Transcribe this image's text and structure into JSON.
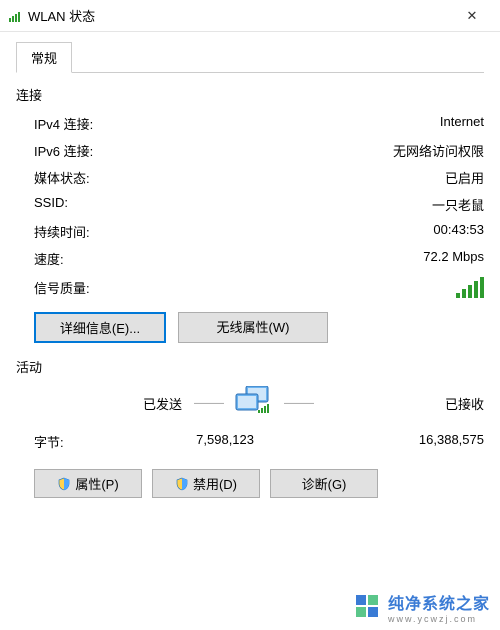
{
  "window": {
    "title": "WLAN 状态",
    "close_glyph": "✕"
  },
  "tabs": {
    "general": "常规"
  },
  "connection": {
    "label": "连接",
    "ipv4_label": "IPv4 连接:",
    "ipv4_value": "Internet",
    "ipv6_label": "IPv6 连接:",
    "ipv6_value": "无网络访问权限",
    "media_label": "媒体状态:",
    "media_value": "已启用",
    "ssid_label": "SSID:",
    "ssid_value": "一只老鼠",
    "duration_label": "持续时间:",
    "duration_value": "00:43:53",
    "speed_label": "速度:",
    "speed_value": "72.2 Mbps",
    "signal_label": "信号质量:"
  },
  "buttons": {
    "details": "详细信息(E)...",
    "wireless_props": "无线属性(W)",
    "properties": "属性(P)",
    "disable": "禁用(D)",
    "diagnose": "诊断(G)"
  },
  "activity": {
    "label": "活动",
    "sent_label": "已发送",
    "recv_label": "已接收",
    "dash": "———",
    "bytes_label": "字节:",
    "sent_value": "7,598,123",
    "recv_value": "16,388,575"
  },
  "watermark": {
    "text": "纯净系统之家",
    "sub": "www.ycwzj.com"
  }
}
